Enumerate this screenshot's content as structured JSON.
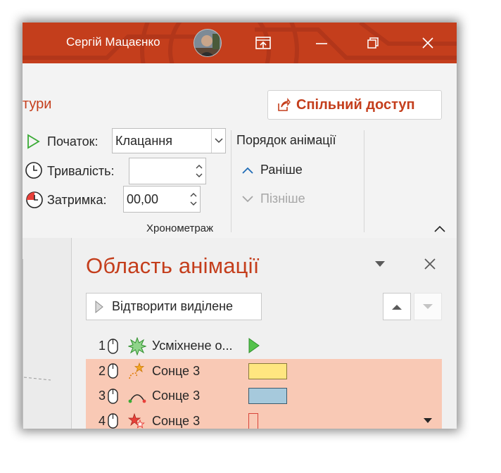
{
  "titlebar": {
    "user_name": "Сергій Мацаєнко",
    "background": "#c43e1c",
    "buttons": [
      "ribbon-display-icon",
      "minimize-icon",
      "restore-icon",
      "close-icon"
    ]
  },
  "ribbon": {
    "tab_fragment": "тури",
    "share_label": "Спільний доступ",
    "start_label": "Початок:",
    "start_value": "Клацання",
    "duration_label": "Тривалість:",
    "duration_value": "",
    "delay_label": "Затримка:",
    "delay_value": "00,00",
    "group_label": "Хронометраж",
    "order_title": "Порядок анімації",
    "earlier_label": "Раніше",
    "later_label": "Пізніше"
  },
  "pane": {
    "title": "Область анімації",
    "play_selected_label": "Відтворити виділене",
    "items": [
      {
        "num": "1",
        "name": "Усміхнене о...",
        "effect_icon": "burst-star-icon",
        "selected": false,
        "timing": "play-arrow",
        "color": "#3aaa35"
      },
      {
        "num": "2",
        "name": "Сонце 3",
        "effect_icon": "path-star-icon",
        "selected": true,
        "timing": "bar",
        "color": "#ffe680"
      },
      {
        "num": "3",
        "name": "Сонце 3",
        "effect_icon": "arc-path-icon",
        "selected": true,
        "timing": "bar",
        "color": "#a6c9dc"
      },
      {
        "num": "4",
        "name": "Сонце 3",
        "effect_icon": "exit-star-icon",
        "selected": true,
        "timing": "thin-bar",
        "color": "#f9c9b5"
      }
    ]
  },
  "colors": {
    "accent": "#c43e1c",
    "selection": "#f9c9b5",
    "ribbon_bg": "#f3f3f3",
    "pane_bg": "#f0f0f0"
  }
}
